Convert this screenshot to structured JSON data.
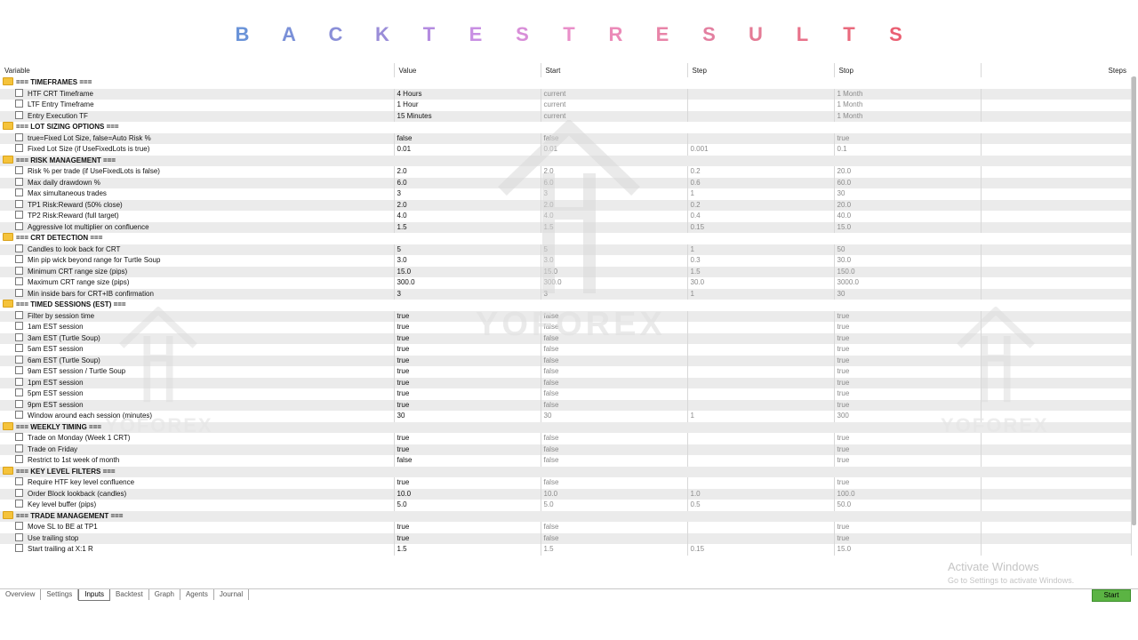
{
  "title_letters": [
    "B",
    "A",
    "C",
    "K",
    "T",
    "E",
    "S",
    "T",
    "R",
    "E",
    "S",
    "U",
    "L",
    "T",
    "S"
  ],
  "title_colors": [
    "#6a93d8",
    "#7a90d8",
    "#8a8fd8",
    "#9a8dd8",
    "#b48ce0",
    "#c88fe3",
    "#d88ed8",
    "#e98fc9",
    "#eb8ab8",
    "#e884a8",
    "#e37fa0",
    "#e47b95",
    "#e8728a",
    "#e96a7d",
    "#ea5f72"
  ],
  "columns": [
    "Variable",
    "Value",
    "Start",
    "Step",
    "Stop",
    "Steps"
  ],
  "rows": [
    {
      "type": "group",
      "name": "=== TIMEFRAMES ==="
    },
    {
      "type": "param",
      "name": "HTF CRT Timeframe",
      "value": "4 Hours",
      "start": "current",
      "step": "",
      "stop": "1 Month"
    },
    {
      "type": "param",
      "name": "LTF Entry Timeframe",
      "value": "1 Hour",
      "start": "current",
      "step": "",
      "stop": "1 Month"
    },
    {
      "type": "param",
      "name": "Entry Execution TF",
      "value": "15 Minutes",
      "start": "current",
      "step": "",
      "stop": "1 Month"
    },
    {
      "type": "group",
      "name": "=== LOT SIZING OPTIONS ==="
    },
    {
      "type": "param",
      "name": "true=Fixed Lot Size, false=Auto Risk %",
      "value": "false",
      "start": "false",
      "step": "",
      "stop": "true"
    },
    {
      "type": "param",
      "name": "Fixed Lot Size (if UseFixedLots is true)",
      "value": "0.01",
      "start": "0.01",
      "step": "0.001",
      "stop": "0.1"
    },
    {
      "type": "group",
      "name": "=== RISK MANAGEMENT ==="
    },
    {
      "type": "param",
      "name": "Risk % per trade (if UseFixedLots is false)",
      "value": "2.0",
      "start": "2.0",
      "step": "0.2",
      "stop": "20.0"
    },
    {
      "type": "param",
      "name": "Max daily drawdown %",
      "value": "6.0",
      "start": "6.0",
      "step": "0.6",
      "stop": "60.0"
    },
    {
      "type": "param",
      "name": "Max simultaneous trades",
      "value": "3",
      "start": "3",
      "step": "1",
      "stop": "30"
    },
    {
      "type": "param",
      "name": "TP1 Risk:Reward (50% close)",
      "value": "2.0",
      "start": "2.0",
      "step": "0.2",
      "stop": "20.0"
    },
    {
      "type": "param",
      "name": "TP2 Risk:Reward (full target)",
      "value": "4.0",
      "start": "4.0",
      "step": "0.4",
      "stop": "40.0"
    },
    {
      "type": "param",
      "name": "Aggressive lot multiplier on confluence",
      "value": "1.5",
      "start": "1.5",
      "step": "0.15",
      "stop": "15.0"
    },
    {
      "type": "group",
      "name": "=== CRT DETECTION ==="
    },
    {
      "type": "param",
      "name": "Candles to look back for CRT",
      "value": "5",
      "start": "5",
      "step": "1",
      "stop": "50"
    },
    {
      "type": "param",
      "name": "Min pip wick beyond range for Turtle Soup",
      "value": "3.0",
      "start": "3.0",
      "step": "0.3",
      "stop": "30.0"
    },
    {
      "type": "param",
      "name": "Minimum CRT range size (pips)",
      "value": "15.0",
      "start": "15.0",
      "step": "1.5",
      "stop": "150.0"
    },
    {
      "type": "param",
      "name": "Maximum CRT range size (pips)",
      "value": "300.0",
      "start": "300.0",
      "step": "30.0",
      "stop": "3000.0"
    },
    {
      "type": "param",
      "name": "Min inside bars for CRT+IB confirmation",
      "value": "3",
      "start": "3",
      "step": "1",
      "stop": "30"
    },
    {
      "type": "group",
      "name": "=== TIMED SESSIONS (EST) ==="
    },
    {
      "type": "param",
      "name": "Filter by session time",
      "value": "true",
      "start": "false",
      "step": "",
      "stop": "true"
    },
    {
      "type": "param",
      "name": "1am EST session",
      "value": "true",
      "start": "false",
      "step": "",
      "stop": "true"
    },
    {
      "type": "param",
      "name": "3am EST (Turtle Soup)",
      "value": "true",
      "start": "false",
      "step": "",
      "stop": "true"
    },
    {
      "type": "param",
      "name": "5am EST session",
      "value": "true",
      "start": "false",
      "step": "",
      "stop": "true"
    },
    {
      "type": "param",
      "name": "6am EST (Turtle Soup)",
      "value": "true",
      "start": "false",
      "step": "",
      "stop": "true"
    },
    {
      "type": "param",
      "name": "9am EST session / Turtle Soup",
      "value": "true",
      "start": "false",
      "step": "",
      "stop": "true"
    },
    {
      "type": "param",
      "name": "1pm EST session",
      "value": "true",
      "start": "false",
      "step": "",
      "stop": "true"
    },
    {
      "type": "param",
      "name": "5pm EST session",
      "value": "true",
      "start": "false",
      "step": "",
      "stop": "true"
    },
    {
      "type": "param",
      "name": "9pm EST session",
      "value": "true",
      "start": "false",
      "step": "",
      "stop": "true"
    },
    {
      "type": "param",
      "name": "Window around each session (minutes)",
      "value": "30",
      "start": "30",
      "step": "1",
      "stop": "300"
    },
    {
      "type": "group",
      "name": "=== WEEKLY TIMING ==="
    },
    {
      "type": "param",
      "name": "Trade on Monday (Week 1 CRT)",
      "value": "true",
      "start": "false",
      "step": "",
      "stop": "true"
    },
    {
      "type": "param",
      "name": "Trade on Friday",
      "value": "true",
      "start": "false",
      "step": "",
      "stop": "true"
    },
    {
      "type": "param",
      "name": "Restrict to 1st week of month",
      "value": "false",
      "start": "false",
      "step": "",
      "stop": "true"
    },
    {
      "type": "group",
      "name": "=== KEY LEVEL FILTERS ==="
    },
    {
      "type": "param",
      "name": "Require HTF key level confluence",
      "value": "true",
      "start": "false",
      "step": "",
      "stop": "true"
    },
    {
      "type": "param",
      "name": "Order Block lookback (candles)",
      "value": "10.0",
      "start": "10.0",
      "step": "1.0",
      "stop": "100.0"
    },
    {
      "type": "param",
      "name": "Key level buffer (pips)",
      "value": "5.0",
      "start": "5.0",
      "step": "0.5",
      "stop": "50.0"
    },
    {
      "type": "group",
      "name": "=== TRADE MANAGEMENT ==="
    },
    {
      "type": "param",
      "name": "Move SL to BE at TP1",
      "value": "true",
      "start": "false",
      "step": "",
      "stop": "true"
    },
    {
      "type": "param",
      "name": "Use trailing stop",
      "value": "true",
      "start": "false",
      "step": "",
      "stop": "true"
    },
    {
      "type": "param",
      "name": "Start trailing at X:1 R",
      "value": "1.5",
      "start": "1.5",
      "step": "0.15",
      "stop": "15.0"
    }
  ],
  "tabs": [
    "Overview",
    "Settings",
    "Inputs",
    "Backtest",
    "Graph",
    "Agents",
    "Journal"
  ],
  "active_tab": "Inputs",
  "start_button": "Start",
  "watermark_text": "YOFOREX",
  "activate_title": "Activate Windows",
  "activate_sub": "Go to Settings to activate Windows."
}
